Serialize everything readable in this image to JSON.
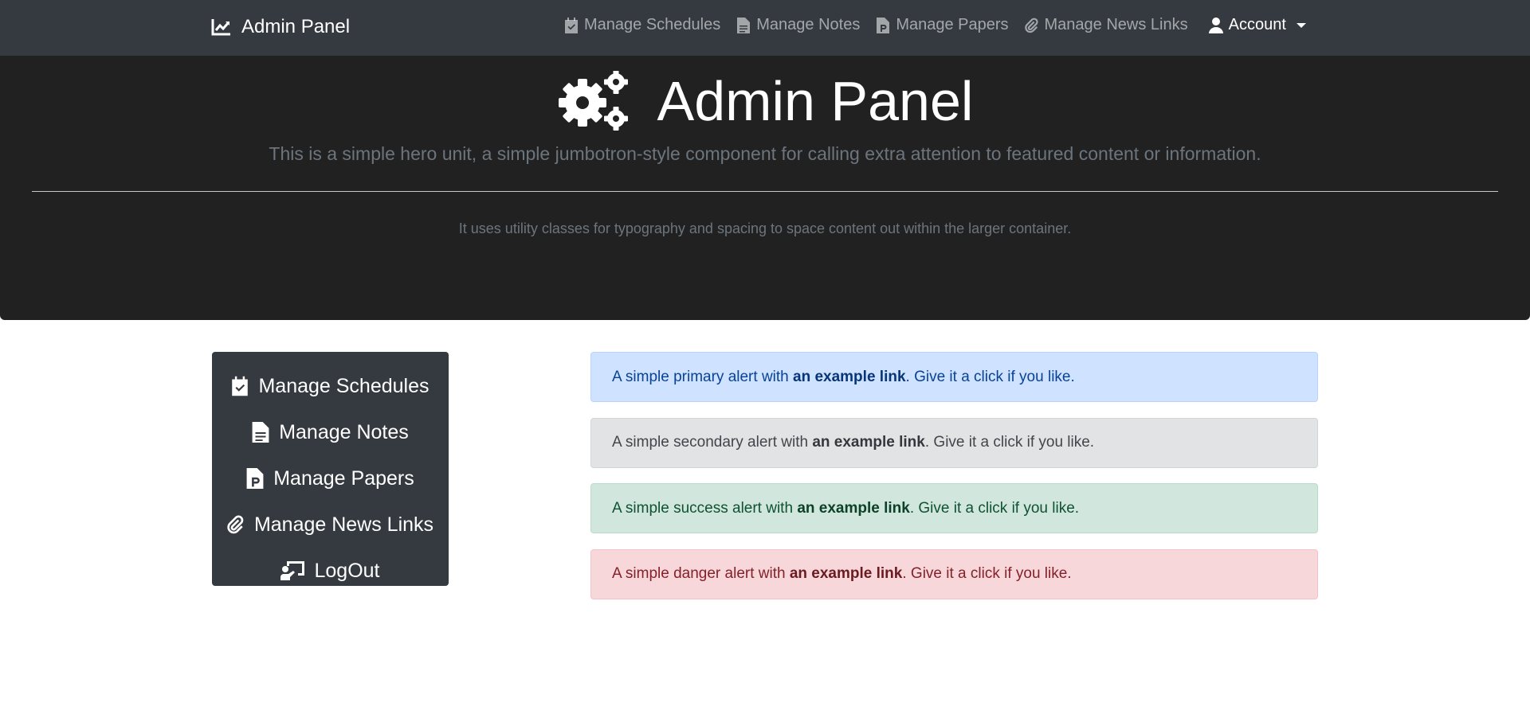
{
  "navbar": {
    "brand": "Admin Panel",
    "links": [
      {
        "label": "Manage Schedules",
        "icon": "calendar-check-icon"
      },
      {
        "label": "Manage Notes",
        "icon": "file-text-icon"
      },
      {
        "label": "Manage Papers",
        "icon": "file-p-icon"
      },
      {
        "label": "Manage News Links",
        "icon": "paperclip-icon"
      }
    ],
    "account": {
      "label": "Account",
      "icon": "user-icon"
    }
  },
  "hero": {
    "title": "Admin Panel",
    "lead": "This is a simple hero unit, a simple jumbotron-style component for calling extra attention to featured content or information.",
    "text": "It uses utility classes for typography and spacing to space content out within the larger container."
  },
  "sidebar": {
    "items": [
      {
        "label": "Manage Schedules",
        "icon": "calendar-check-icon"
      },
      {
        "label": "Manage Notes",
        "icon": "file-text-icon"
      },
      {
        "label": "Manage Papers",
        "icon": "file-p-icon"
      },
      {
        "label": "Manage News Links",
        "icon": "paperclip-icon"
      },
      {
        "label": "LogOut",
        "icon": "chalkboard-user-icon"
      }
    ]
  },
  "alerts": [
    {
      "type": "primary",
      "before": "A simple primary alert with ",
      "link": "an example link",
      "after": ". Give it a click if you like."
    },
    {
      "type": "secondary",
      "before": "A simple secondary alert with ",
      "link": "an example link",
      "after": ". Give it a click if you like."
    },
    {
      "type": "success",
      "before": "A simple success alert with ",
      "link": "an example link",
      "after": ". Give it a click if you like."
    },
    {
      "type": "danger",
      "before": "A simple danger alert with ",
      "link": "an example link",
      "after": ". Give it a click if you like."
    }
  ],
  "colors": {
    "navbar_bg": "#343a40",
    "hero_bg": "#212121",
    "sidebar_bg": "#343a40",
    "muted_text": "#6c757d"
  }
}
